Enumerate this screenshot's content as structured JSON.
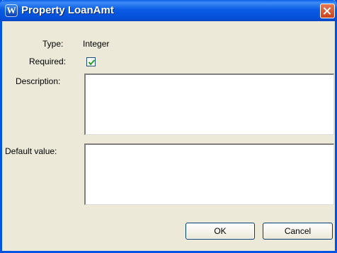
{
  "window": {
    "title": "Property LoanAmt"
  },
  "form": {
    "type_label": "Type:",
    "type_value": "Integer",
    "required_label": "Required:",
    "required_checked": true,
    "description_label": "Description:",
    "description_value": "",
    "default_label": "Default value:",
    "default_value": ""
  },
  "buttons": {
    "ok": "OK",
    "cancel": "Cancel"
  },
  "icons": {
    "app": "w-logo-icon",
    "close": "close-icon",
    "check": "checkmark-icon"
  }
}
